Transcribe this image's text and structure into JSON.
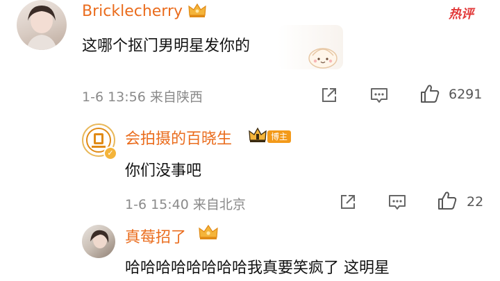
{
  "comments": [
    {
      "username": "Bricklecherry",
      "text": "这哪个抠门男明星发你的",
      "meta": "1-6 13:56 来自陕西",
      "like_count": "6291",
      "tag": "热评"
    },
    {
      "username": "会拍摄的百晓生",
      "badge": "博主",
      "text": "你们没事吧",
      "meta": "1-6 15:40 来自北京",
      "like_count": "22"
    },
    {
      "username": "真莓招了",
      "text": "哈哈哈哈哈哈哈哈我真要笑疯了 这明星"
    }
  ],
  "icons": {
    "share": "share-icon",
    "comment": "comment-icon",
    "like": "like-icon",
    "crown": "crown-icon",
    "vip": "vip-crown-icon",
    "verified": "verified-icon"
  },
  "colors": {
    "username": "#ea6c1d",
    "hot": "#e23a3a",
    "badge": "#f39a1a"
  }
}
